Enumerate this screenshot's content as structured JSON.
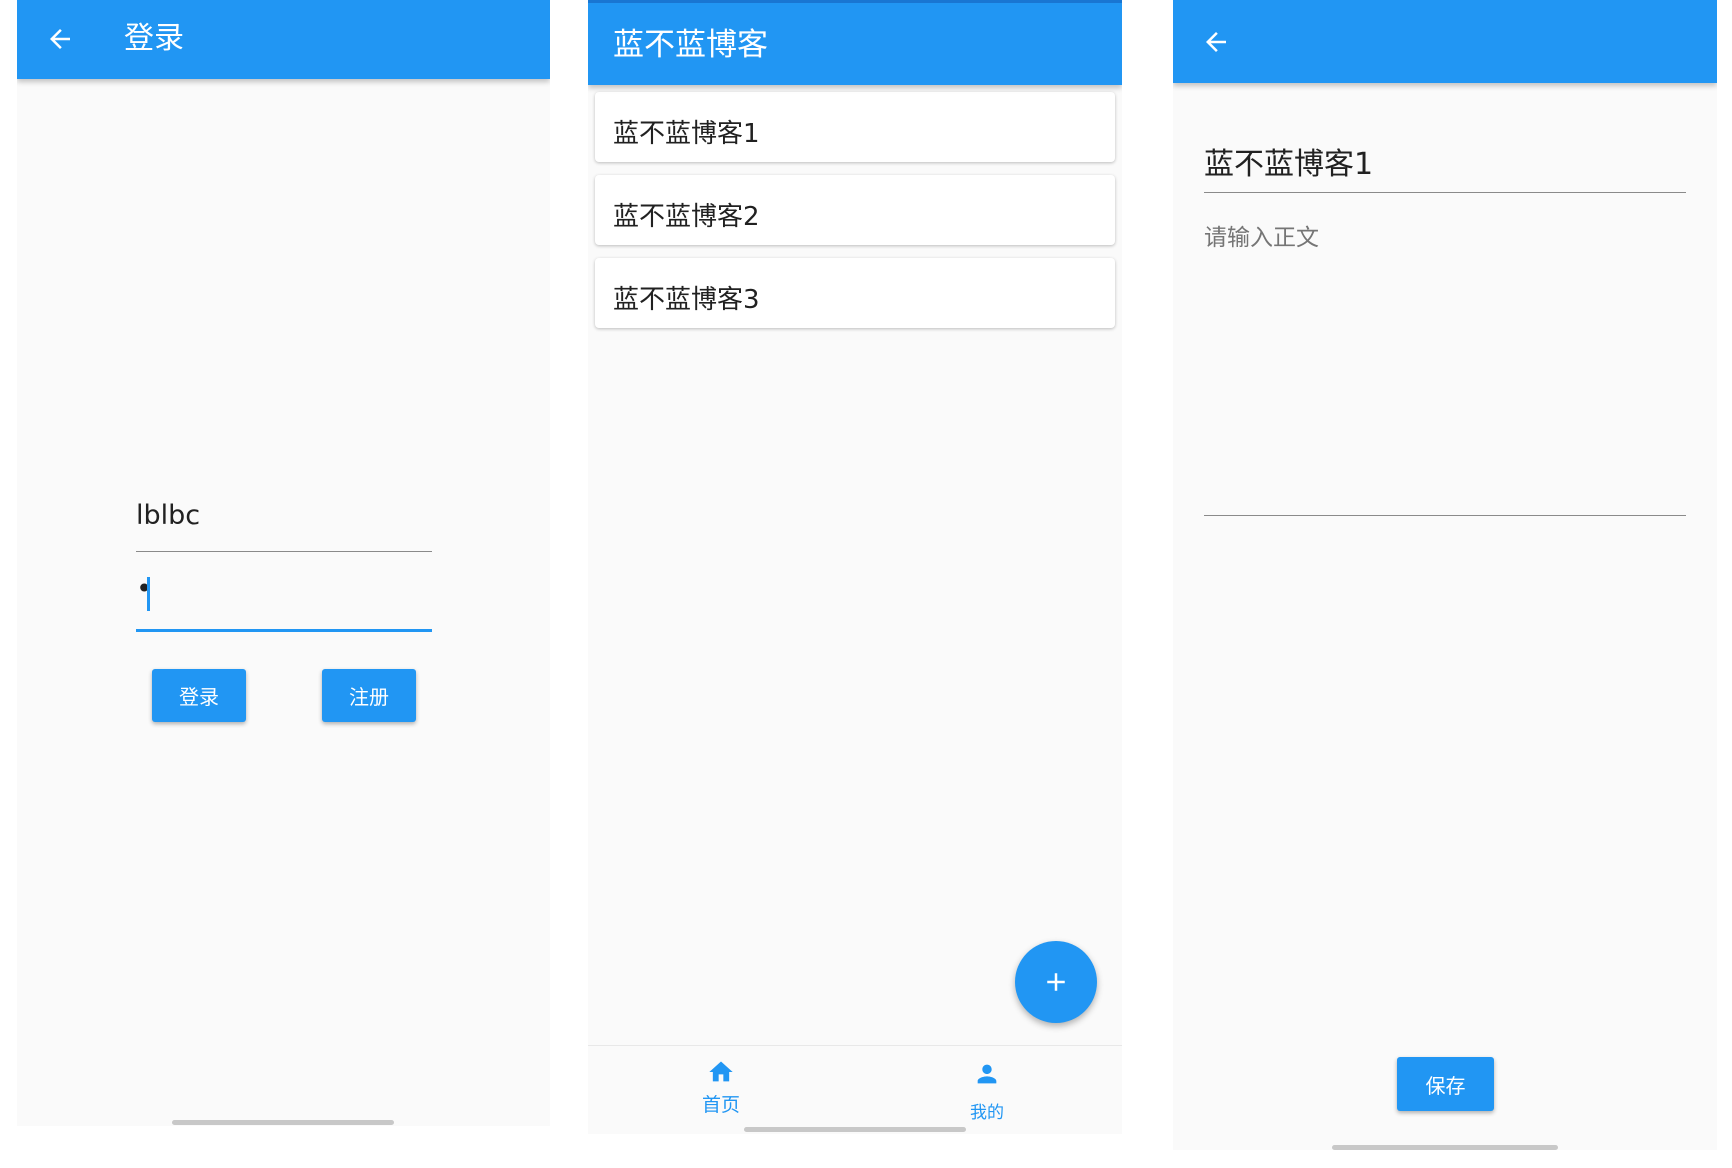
{
  "login_screen": {
    "title": "登录",
    "username_value": "lblbc",
    "password_value": "•",
    "login_button": "登录",
    "register_button": "注册"
  },
  "list_screen": {
    "title": "蓝不蓝博客",
    "items": [
      {
        "label": "蓝不蓝博客1"
      },
      {
        "label": "蓝不蓝博客2"
      },
      {
        "label": "蓝不蓝博客3"
      }
    ],
    "fab_icon": "plus-icon",
    "nav": {
      "home_label": "首页",
      "home_icon": "home-icon",
      "mine_label": "我的",
      "mine_icon": "person-icon"
    }
  },
  "edit_screen": {
    "title_value": "蓝不蓝博客1",
    "body_placeholder": "请输入正文",
    "save_button": "保存"
  },
  "colors": {
    "primary": "#2196f3",
    "background": "#fafafa",
    "card": "#ffffff"
  }
}
